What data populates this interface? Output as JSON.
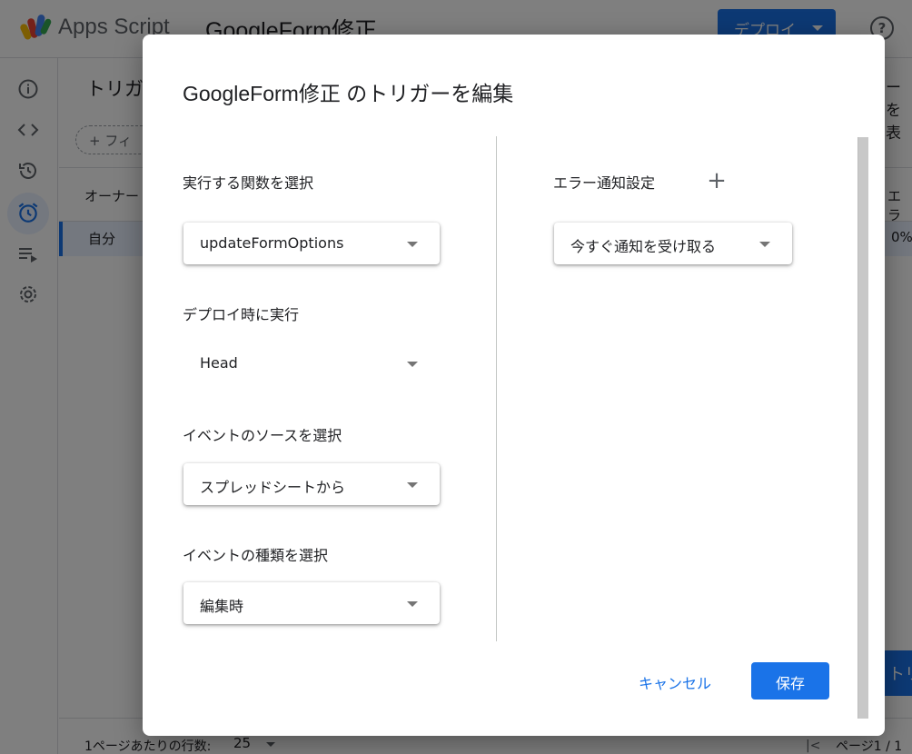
{
  "app": {
    "name": "Apps Script",
    "project_name": "GoogleForm修正",
    "deploy_label": "デプロイ",
    "help_icon": "?"
  },
  "nav": {
    "icons": [
      "info-icon",
      "code-icon",
      "history-icon",
      "alarm-clock-icon",
      "executions-icon",
      "settings-icon"
    ],
    "active": "alarm-clock-icon"
  },
  "triggers_page": {
    "title": "トリガー",
    "right_header_cut": "ーを表",
    "filter_label": "フィ",
    "col_owner": "オーナー",
    "col_error_cut": "エラ",
    "row_owner": "自分",
    "row_error_rate": "0%",
    "add_trigger_cut": "トリ",
    "rows_per_page_label": "1ページあたりの行数:",
    "rows_per_page_value": "25",
    "page_label": "ページ1 / 1"
  },
  "dialog": {
    "title": "GoogleForm修正 のトリガーを編集",
    "function_label": "実行する関数を選択",
    "function_value": "updateFormOptions",
    "deploy_label": "デプロイ時に実行",
    "deploy_value": "Head",
    "source_label": "イベントのソースを選択",
    "source_value": "スプレッドシートから",
    "event_type_label": "イベントの種類を選択",
    "event_type_value": "編集時",
    "error_label": "エラー通知設定",
    "add_icon": "+",
    "error_value": "今すぐ通知を受け取る",
    "cancel": "キャンセル",
    "save": "保存"
  },
  "colors": {
    "primary": "#1a73e8",
    "overlay": "rgba(0,0,0,0.5)"
  }
}
